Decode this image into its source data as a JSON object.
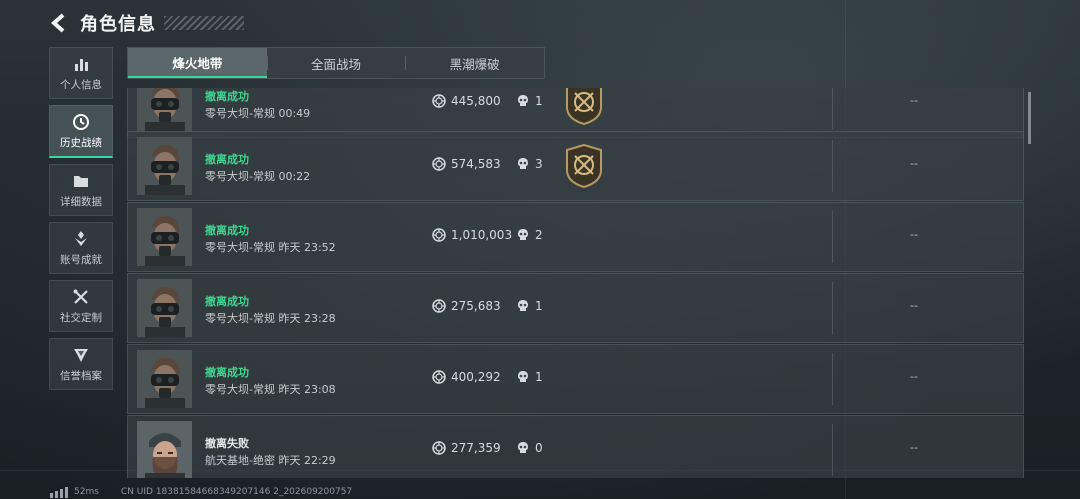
{
  "header": {
    "title": "角色信息"
  },
  "sidebar": {
    "items": [
      {
        "label": "个人信息",
        "icon": "bar-chart-icon",
        "active": false
      },
      {
        "label": "历史战绩",
        "icon": "history-clock-icon",
        "active": true
      },
      {
        "label": "详细数据",
        "icon": "folder-icon",
        "active": false
      },
      {
        "label": "账号成就",
        "icon": "achievement-icon",
        "active": false
      },
      {
        "label": "社交定制",
        "icon": "tools-icon",
        "active": false
      },
      {
        "label": "信誉档案",
        "icon": "badge-icon",
        "active": false
      }
    ]
  },
  "tabs": [
    {
      "label": "烽火地带",
      "active": true
    },
    {
      "label": "全面战场",
      "active": false
    },
    {
      "label": "黑潮爆破",
      "active": false
    }
  ],
  "records": [
    {
      "status": "撤离成功",
      "status_kind": "success",
      "map": "零号大坝-常规 00:49",
      "value": "445,800",
      "kills": "1",
      "medal": true,
      "extra": "--",
      "avatar": "operator-gasmask"
    },
    {
      "status": "撤离成功",
      "status_kind": "success",
      "map": "零号大坝-常规 00:22",
      "value": "574,583",
      "kills": "3",
      "medal": true,
      "extra": "--",
      "avatar": "operator-gasmask"
    },
    {
      "status": "撤离成功",
      "status_kind": "success",
      "map": "零号大坝-常规 昨天 23:52",
      "value": "1,010,003",
      "kills": "2",
      "medal": false,
      "extra": "--",
      "avatar": "operator-gasmask"
    },
    {
      "status": "撤离成功",
      "status_kind": "success",
      "map": "零号大坝-常规 昨天 23:28",
      "value": "275,683",
      "kills": "1",
      "medal": false,
      "extra": "--",
      "avatar": "operator-gasmask"
    },
    {
      "status": "撤离成功",
      "status_kind": "success",
      "map": "零号大坝-常规 昨天 23:08",
      "value": "400,292",
      "kills": "1",
      "medal": false,
      "extra": "--",
      "avatar": "operator-gasmask"
    },
    {
      "status": "撤离失败",
      "status_kind": "fail",
      "map": "航天基地-绝密 昨天 22:29",
      "value": "277,359",
      "kills": "0",
      "medal": false,
      "extra": "--",
      "avatar": "operator-helmet"
    }
  ],
  "footer": {
    "ping": "52ms",
    "uid": "CN UID 18381584668349207146 2_202609200757"
  },
  "colors": {
    "accent": "#3bd6a0",
    "success": "#3fd68f",
    "medal": "#b69a62"
  }
}
